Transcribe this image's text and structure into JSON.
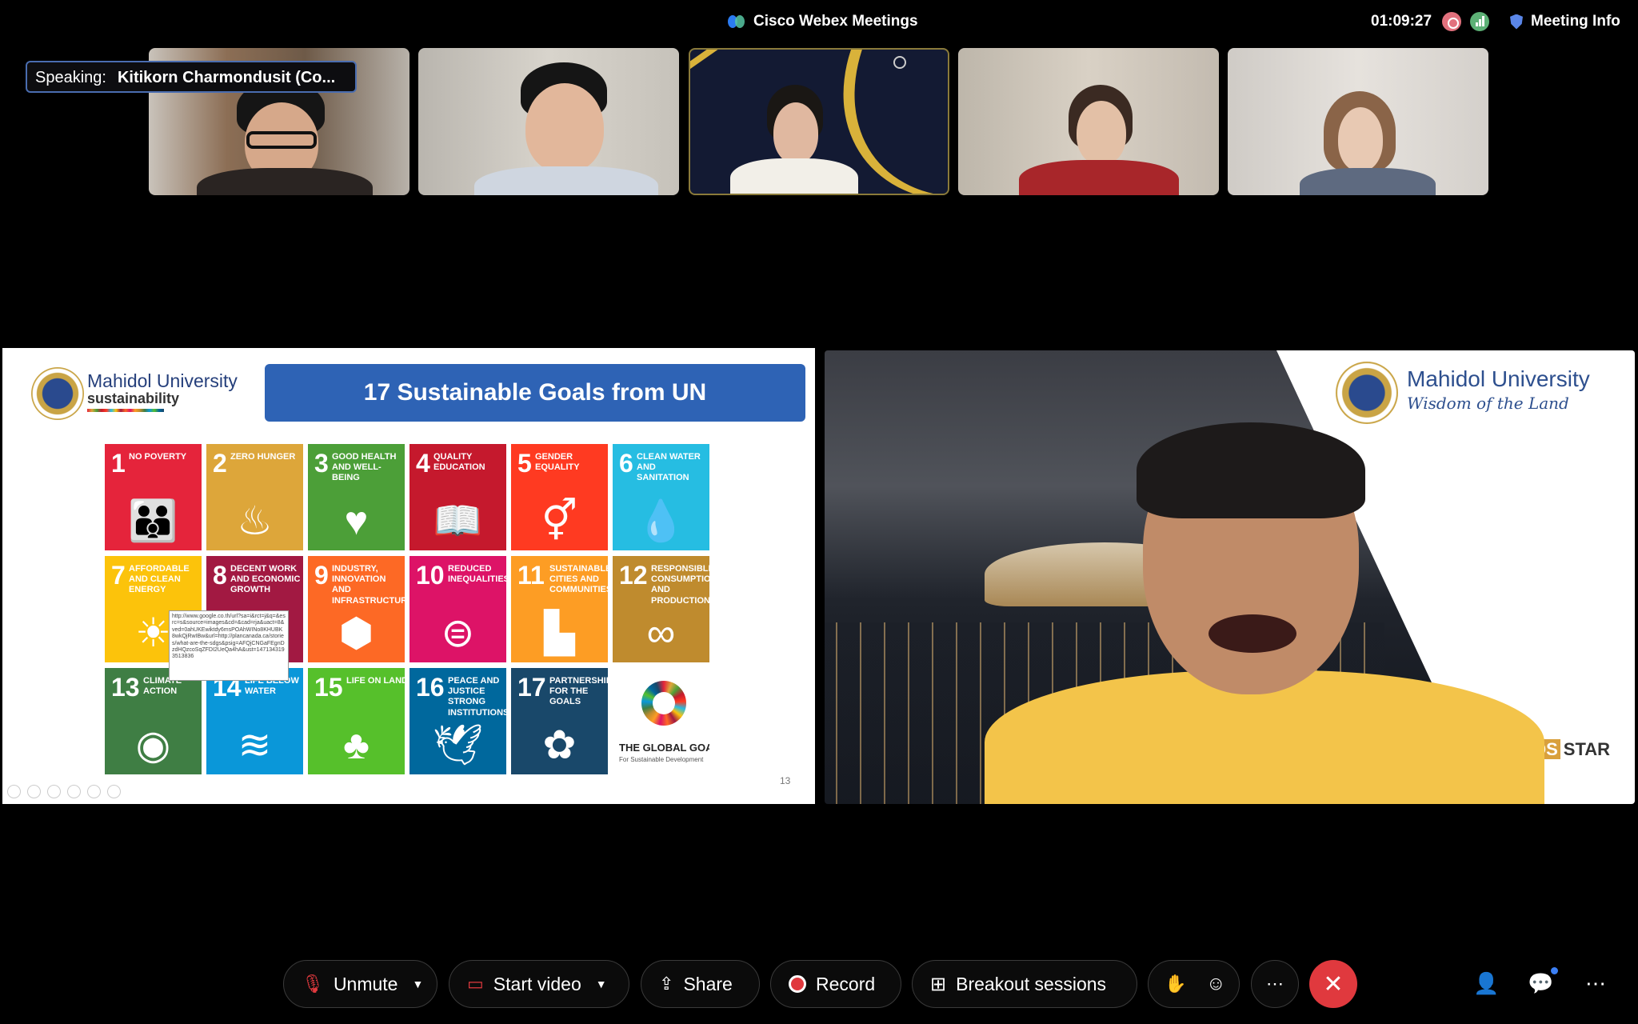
{
  "app": {
    "title": "Cisco Webex Meetings",
    "timer": "01:09:27",
    "meeting_info": "Meeting Info"
  },
  "speaking": {
    "label": "Speaking:",
    "name": "Kitikorn Charmondusit (Co..."
  },
  "slide": {
    "org_name": "Mahidol University",
    "org_sub": "sustainability",
    "title": "17 Sustainable Goals from UN",
    "page": "13",
    "tooltip_text": "http://www.google.co.th/url?sa=i&rct=j&q=&esrc=s&source=images&cd=&cad=rja&uact=8&ved=0ahUKEwiktdy6msPOAhWINo8KHUBK8wkQjRwIBw&url=http://plancanada.ca/stories/what-are-the-sdgs&psig=AFQjCNGaFEgnDzdHQzcoSqZFDI2UeQa4hA&ust=1471343193513836",
    "goals": [
      {
        "num": "1",
        "label": "No Poverty",
        "color": "#e5243b",
        "icon": "family-icon",
        "glyph": "👪"
      },
      {
        "num": "2",
        "label": "Zero Hunger",
        "color": "#dda63a",
        "icon": "bowl-icon",
        "glyph": "♨"
      },
      {
        "num": "3",
        "label": "Good Health and Well-Being",
        "color": "#4c9f38",
        "icon": "heartbeat-icon",
        "glyph": "♥"
      },
      {
        "num": "4",
        "label": "Quality Education",
        "color": "#c5192d",
        "icon": "book-icon",
        "glyph": "📖"
      },
      {
        "num": "5",
        "label": "Gender Equality",
        "color": "#ff3a21",
        "icon": "gender-icon",
        "glyph": "⚥"
      },
      {
        "num": "6",
        "label": "Clean Water and Sanitation",
        "color": "#26bde2",
        "icon": "water-drop-icon",
        "glyph": "💧"
      },
      {
        "num": "7",
        "label": "Affordable and Clean Energy",
        "color": "#fcc30b",
        "icon": "sun-power-icon",
        "glyph": "☀"
      },
      {
        "num": "8",
        "label": "Decent Work and Economic Growth",
        "color": "#a21942",
        "icon": "growth-chart-icon",
        "glyph": "↗"
      },
      {
        "num": "9",
        "label": "Industry, Innovation and Infrastructure",
        "color": "#fd6925",
        "icon": "cubes-icon",
        "glyph": "⬢"
      },
      {
        "num": "10",
        "label": "Reduced Inequalities",
        "color": "#dd1367",
        "icon": "equal-icon",
        "glyph": "⊜"
      },
      {
        "num": "11",
        "label": "Sustainable Cities and Communities",
        "color": "#fd9d24",
        "icon": "city-icon",
        "glyph": "▙"
      },
      {
        "num": "12",
        "label": "Responsible Consumption and Production",
        "color": "#bf8b2e",
        "icon": "infinity-icon",
        "glyph": "∞"
      },
      {
        "num": "13",
        "label": "Climate Action",
        "color": "#3f7e44",
        "icon": "eye-globe-icon",
        "glyph": "◉"
      },
      {
        "num": "14",
        "label": "Life Below Water",
        "color": "#0a97d9",
        "icon": "fish-icon",
        "glyph": "≋"
      },
      {
        "num": "15",
        "label": "Life on Land",
        "color": "#56c02b",
        "icon": "tree-icon",
        "glyph": "♣"
      },
      {
        "num": "16",
        "label": "Peace and Justice Strong Institutions",
        "color": "#00689d",
        "icon": "dove-icon",
        "glyph": "🕊"
      },
      {
        "num": "17",
        "label": "Partnerships for the Goals",
        "color": "#19486a",
        "icon": "flower-rings-icon",
        "glyph": "✿"
      }
    ],
    "global_goals": {
      "title": "THE GLOBAL GOALS",
      "sub": "For Sustainable Development"
    }
  },
  "video": {
    "org_name": "Mahidol University",
    "org_motto": "Wisdom of the Land",
    "qs_label": "STAR",
    "qs_badge": "QS"
  },
  "toolbar": {
    "unmute": "Unmute",
    "start_video": "Start video",
    "share": "Share",
    "record": "Record",
    "breakout": "Breakout sessions",
    "more": "⋯",
    "end": "✕"
  }
}
